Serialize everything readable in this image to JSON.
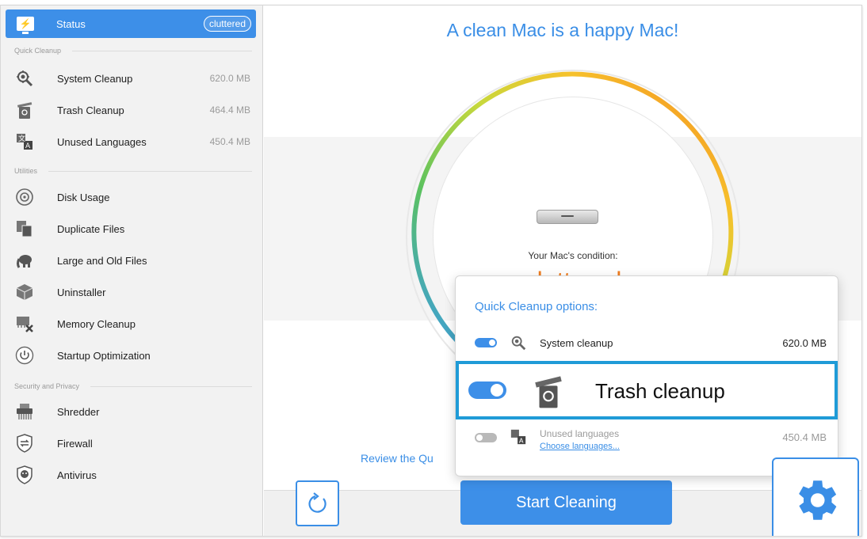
{
  "sidebar": {
    "status": {
      "label": "Status",
      "badge": "cluttered"
    },
    "sections": {
      "quick": "Quick Cleanup",
      "utilities": "Utilities",
      "security": "Security and Privacy"
    },
    "quick_items": [
      {
        "label": "System Cleanup",
        "size": "620.0 MB",
        "icon": "gear-magnifier-icon"
      },
      {
        "label": "Trash Cleanup",
        "size": "464.4 MB",
        "icon": "trash-icon"
      },
      {
        "label": "Unused Languages",
        "size": "450.4 MB",
        "icon": "language-icon"
      }
    ],
    "utility_items": [
      {
        "label": "Disk Usage",
        "icon": "disk-icon"
      },
      {
        "label": "Duplicate Files",
        "icon": "duplicate-files-icon"
      },
      {
        "label": "Large and Old Files",
        "icon": "elephant-icon"
      },
      {
        "label": "Uninstaller",
        "icon": "box-icon"
      },
      {
        "label": "Memory Cleanup",
        "icon": "memory-icon"
      },
      {
        "label": "Startup Optimization",
        "icon": "power-icon"
      }
    ],
    "security_items": [
      {
        "label": "Shredder",
        "icon": "shredder-icon"
      },
      {
        "label": "Firewall",
        "icon": "firewall-icon"
      },
      {
        "label": "Antivirus",
        "icon": "antivirus-icon"
      }
    ]
  },
  "main": {
    "headline": "A clean Mac is a happy Mac!",
    "condition_label": "Your Mac's condition:",
    "condition_value": "cluttered",
    "review_link": "Review the Qu",
    "start_button": "Start Cleaning"
  },
  "popover": {
    "title": "Quick Cleanup options:",
    "options": [
      {
        "label": "System cleanup",
        "size": "620.0 MB",
        "enabled": true
      },
      {
        "label": "Trash cleanup",
        "enabled": true
      },
      {
        "label": "Unused languages",
        "size": "450.4 MB",
        "enabled": false,
        "link": "Choose languages..."
      }
    ]
  },
  "colors": {
    "accent": "#3d8fe8",
    "condition": "#f07d1f",
    "highlight": "#1f9bd7"
  }
}
